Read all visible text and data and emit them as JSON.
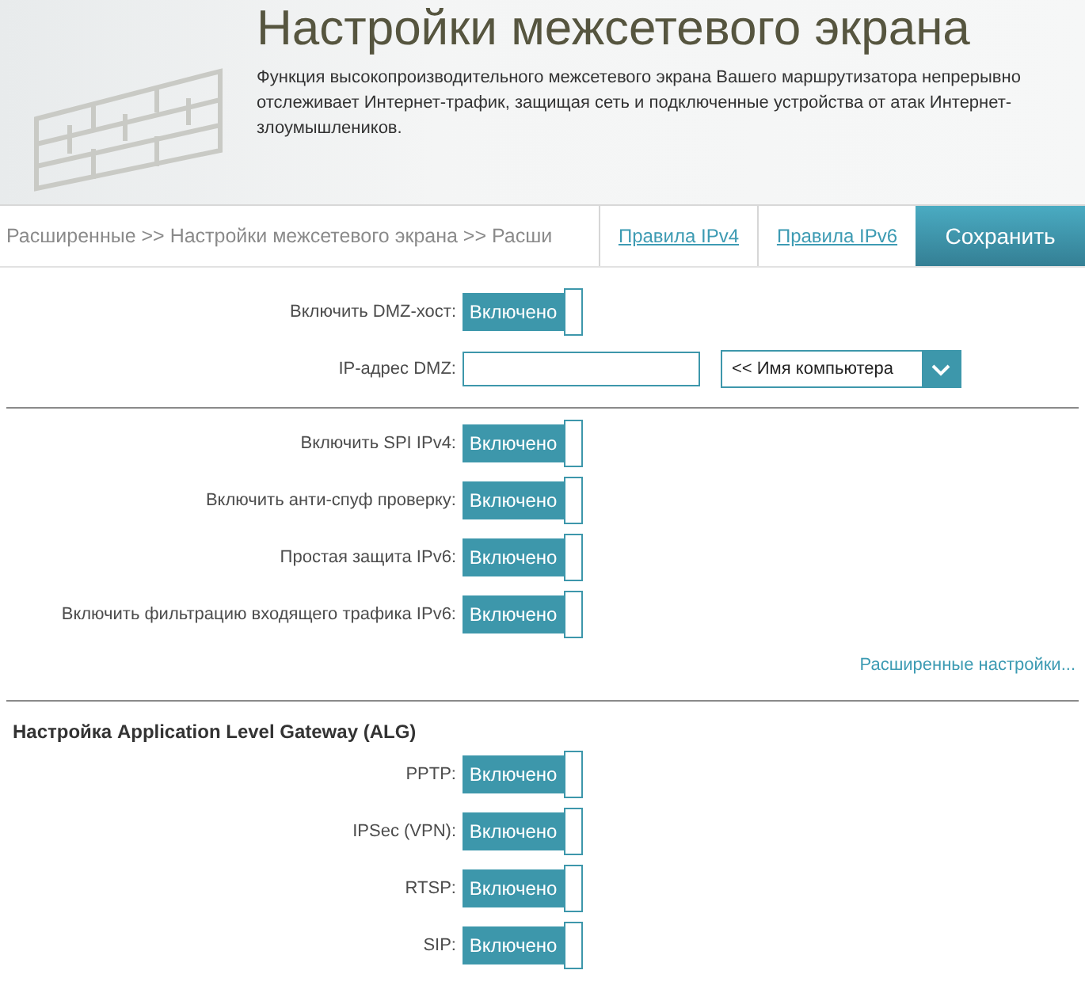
{
  "header": {
    "title": "Настройки межсетевого экрана",
    "description": "Функция высокопроизводительного межсетевого экрана Вашего маршрутизатора непрерывно отслеживает Интернет-трафик, защищая сеть и подключенные устройства от атак Интернет-злоумышлеников."
  },
  "nav": {
    "breadcrumb": "Расширенные >> Настройки межсетевого экрана >> Расши",
    "links": [
      "Правила IPv4",
      "Правила IPv6"
    ],
    "save_button": "Сохранить"
  },
  "dmz": {
    "toggle": {
      "label": "Включить DMZ-хост:",
      "text": "Включено",
      "on": true
    },
    "ip_label": "IP-адрес DMZ:",
    "computer_select": "<< Имя компьютера"
  },
  "security": [
    {
      "label": "Включить SPI IPv4:",
      "text": "Включено",
      "on": true
    },
    {
      "label": "Включить анти-спуф проверку:",
      "text": "Включено",
      "on": true
    },
    {
      "label": "Простая защита IPv6:",
      "text": "Включено",
      "on": true
    },
    {
      "label": "Включить фильтрацию входящего трафика IPv6:",
      "text": "Включено",
      "on": true
    }
  ],
  "advanced_link": "Расширенные настройки...",
  "alg": {
    "title": "Настройка Application Level Gateway (ALG)",
    "items": [
      {
        "label": "PPTP:",
        "text": "Включено",
        "on": true
      },
      {
        "label": "IPSec (VPN):",
        "text": "Включено",
        "on": true
      },
      {
        "label": "RTSP:",
        "text": "Включено",
        "on": true
      },
      {
        "label": "SIP:",
        "text": "Включено",
        "on": true
      }
    ]
  }
}
